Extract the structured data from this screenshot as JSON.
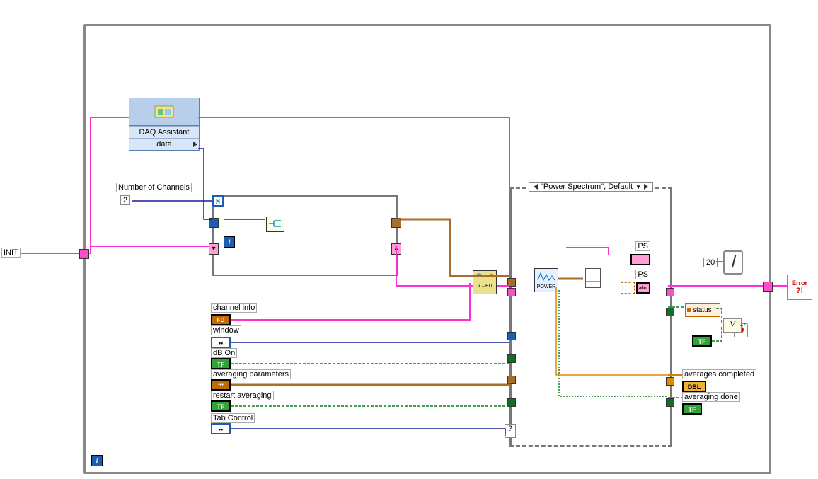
{
  "init_label": "INIT",
  "num_channels": {
    "label": "Number of Channels",
    "value": "2"
  },
  "daq": {
    "title": "DAQ Assistant",
    "out": "data"
  },
  "for_loop": {
    "N": "N",
    "i": "i"
  },
  "while_loop": {
    "i": "i"
  },
  "case": {
    "selector": "\"Power Spectrum\", Default"
  },
  "controls": {
    "channel_info": "channel info",
    "window": "window",
    "db_on": "dB On",
    "avg_params": "averaging parameters",
    "restart_avg": "restart averaging",
    "tab": "Tab Control"
  },
  "indicators": {
    "ps1": "PS",
    "ps2": "PS",
    "status": "status",
    "avg_completed": "averages completed",
    "avg_done": "averaging done"
  },
  "wait_ms": "20",
  "subvi": {
    "vtoeu": "V→EU",
    "power": "POWER"
  },
  "terminals": {
    "tf": "TF",
    "dbl": "DBL",
    "i32": "I32",
    "cluster": "•••",
    "tab": "••"
  },
  "error_handler": "Error"
}
